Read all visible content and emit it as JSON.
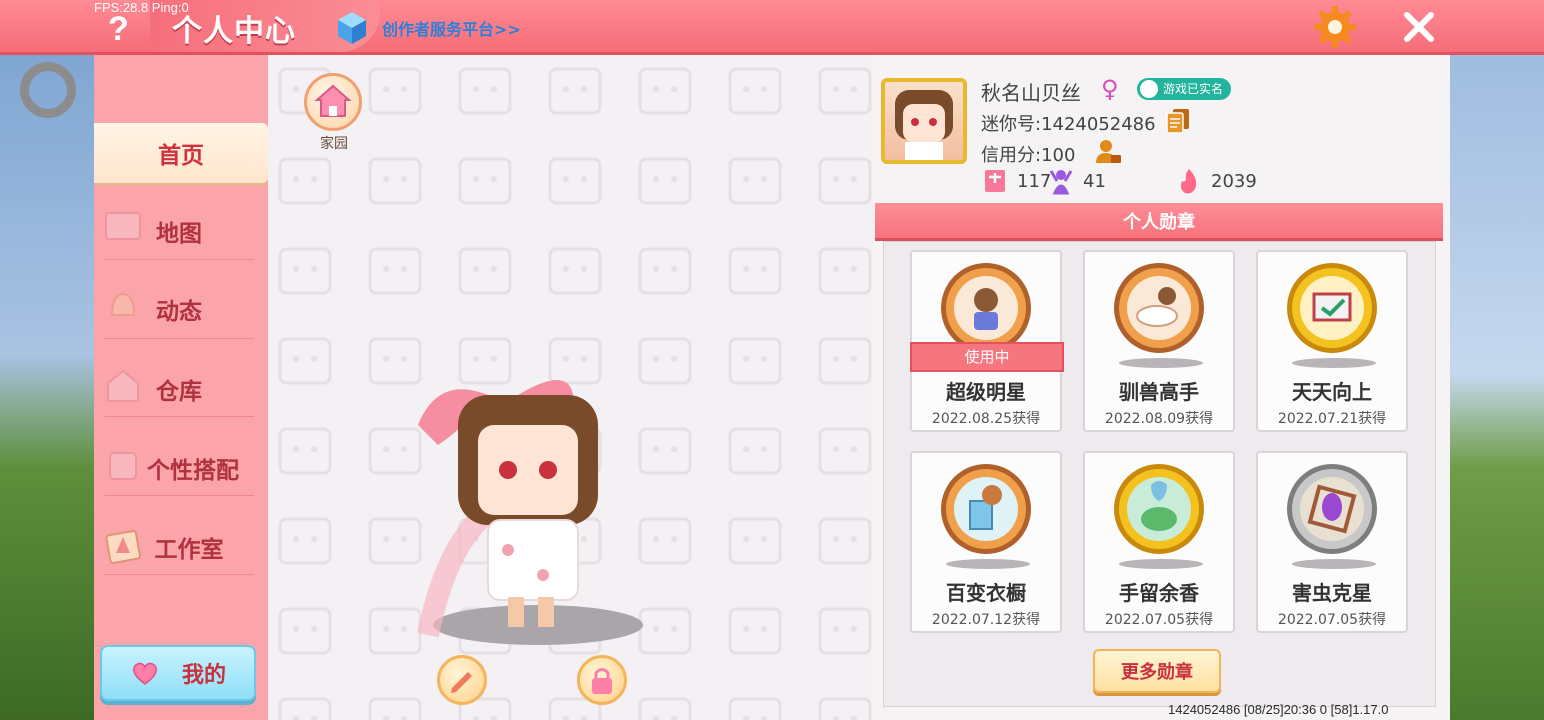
{
  "debug": {
    "fps": "FPS:28.8  Ping:0"
  },
  "header": {
    "help_icon": "?",
    "title": "个人中心",
    "creator_link": "创作者服务平台>>",
    "accent": "#f56e79"
  },
  "nav": {
    "items": [
      {
        "label": "首页",
        "active": true
      },
      {
        "label": "地图"
      },
      {
        "label": "动态"
      },
      {
        "label": "仓库"
      },
      {
        "label": "个性搭配"
      },
      {
        "label": "工作室"
      }
    ],
    "mine_label": "我的"
  },
  "center": {
    "home_label": "家园"
  },
  "profile": {
    "nickname": "秋名山贝丝",
    "gender_symbol": "♀",
    "verified_label": "游戏已实名",
    "mini_id": "迷你号:1424052486",
    "credit": "信用分:100",
    "stats": {
      "a": "117",
      "b": "41",
      "c": "2039"
    }
  },
  "badges": {
    "header": "个人勋章",
    "in_use_label": "使用中",
    "items": [
      {
        "name": "超级明星",
        "date": "2022.08.25获得",
        "color": "#e08a3c",
        "in_use": true
      },
      {
        "name": "驯兽高手",
        "date": "2022.08.09获得",
        "color": "#e08a3c"
      },
      {
        "name": "天天向上",
        "date": "2022.07.21获得",
        "color": "#e9b11c"
      },
      {
        "name": "百变衣橱",
        "date": "2022.07.12获得",
        "color": "#e08a3c"
      },
      {
        "name": "手留余香",
        "date": "2022.07.05获得",
        "color": "#e9b11c"
      },
      {
        "name": "害虫克星",
        "date": "2022.07.05获得",
        "color": "#9c9c9c"
      }
    ],
    "more_label": "更多勋章"
  },
  "footer": {
    "info": "1424052486    [08/25]20:36 0    [58]1.17.0"
  }
}
